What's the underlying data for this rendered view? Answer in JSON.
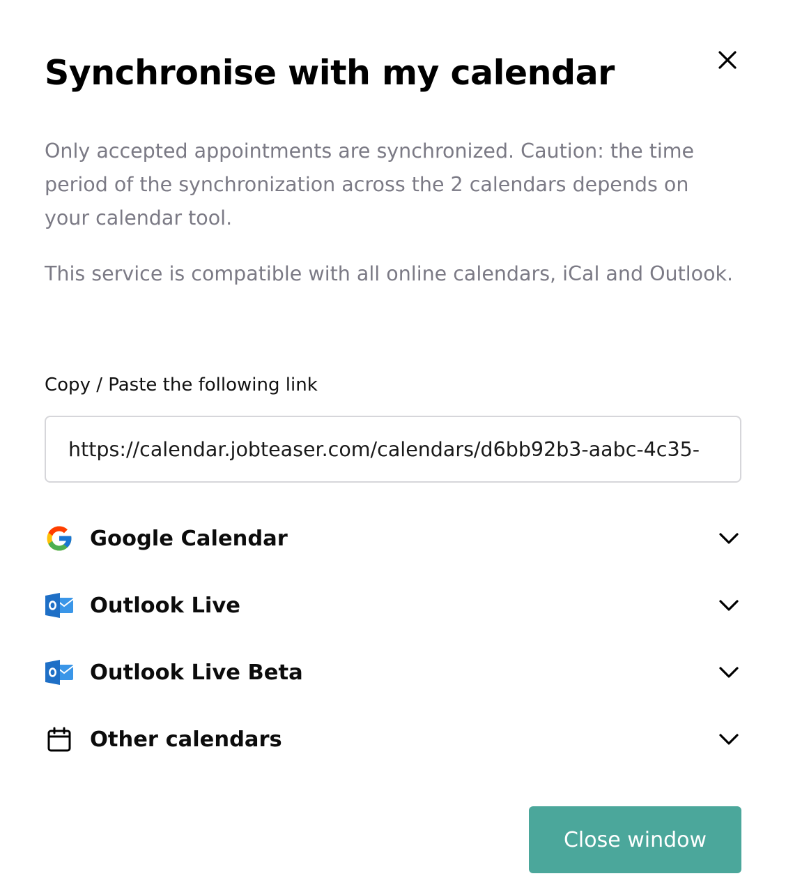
{
  "modal": {
    "title": "Synchronise with my calendar",
    "description_1": "Only accepted appointments are synchronized. Caution: the time period of the synchronization across the 2 calendars depends on your calendar tool.",
    "description_2": "This service is compatible with all online calendars, iCal and Outlook.",
    "link_label": "Copy / Paste the following link",
    "link_value": "https://calendar.jobteaser.com/calendars/d6bb92b3-aabc-4c35-",
    "close_icon": "close-icon",
    "calendars": [
      {
        "label": "Google Calendar",
        "icon": "google-icon"
      },
      {
        "label": "Outlook Live",
        "icon": "outlook-icon"
      },
      {
        "label": "Outlook Live Beta",
        "icon": "outlook-icon"
      },
      {
        "label": "Other calendars",
        "icon": "calendar-icon"
      }
    ],
    "close_button_label": "Close window"
  },
  "colors": {
    "primary_button": "#4ba79b",
    "description_text": "#7b7a85",
    "input_border": "#d6d6da",
    "outlook_blue": "#1e6fc6"
  }
}
